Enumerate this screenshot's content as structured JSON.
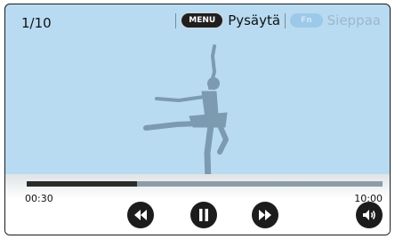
{
  "player": {
    "counter": "1/10",
    "menu_key": "MENU",
    "stop_label": "Pysäytä",
    "fn_key": "Fn",
    "capture_label": "Sieppaa"
  },
  "playback": {
    "current_time": "00:30",
    "total_time": "10:00",
    "progress": 0.31
  },
  "icons": [
    "rewind-icon",
    "pause-icon",
    "fast-forward-icon",
    "volume-icon"
  ],
  "colors": {
    "screen_background": "#b8dbf2",
    "progress_fill": "#2b2b2b",
    "progress_track": "#8d9da8",
    "button": "#1c1c1c"
  }
}
